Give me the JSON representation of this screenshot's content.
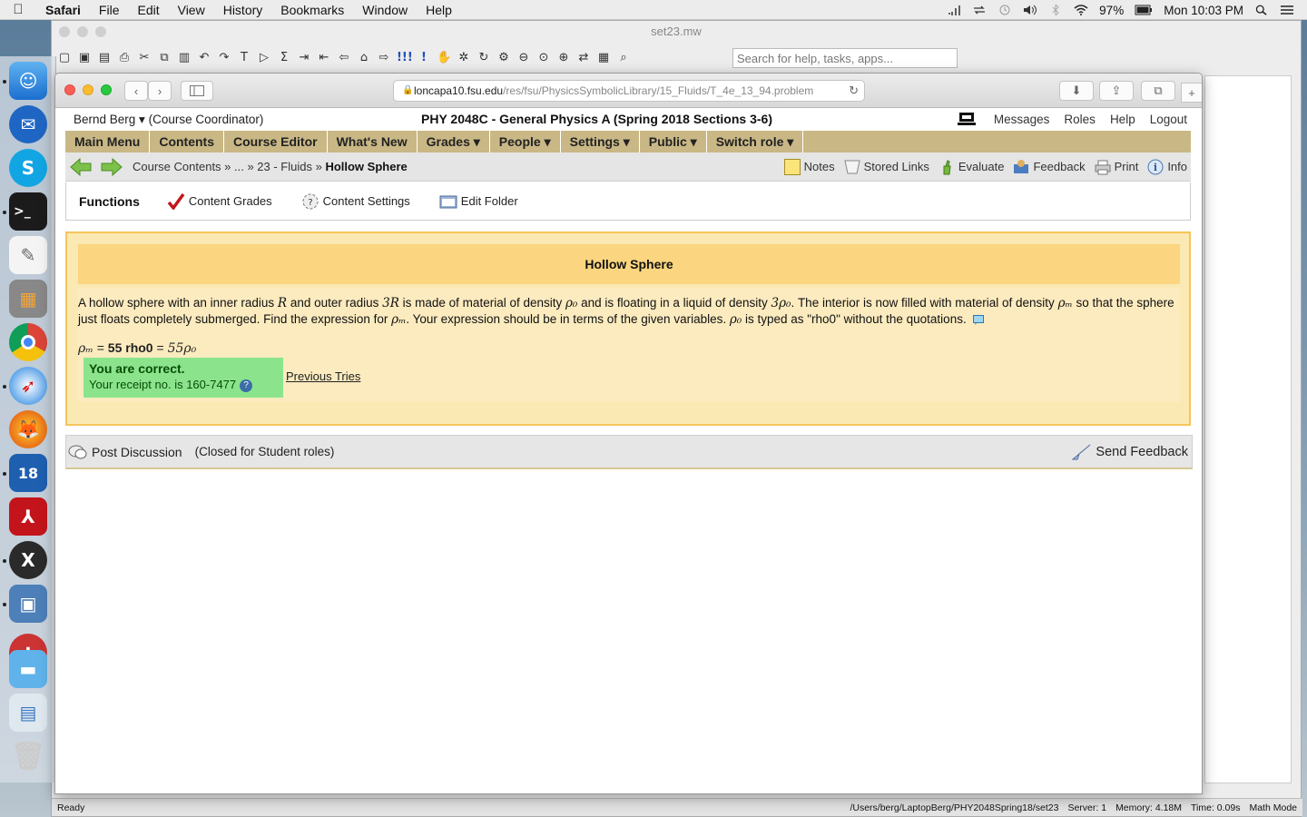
{
  "menubar": {
    "app": "Safari",
    "items": [
      "File",
      "Edit",
      "View",
      "History",
      "Bookmarks",
      "Window",
      "Help"
    ],
    "battery": "97%",
    "clock": "Mon 10:03 PM"
  },
  "maple": {
    "title": "set23.mw",
    "search_placeholder": "Search for help, tasks, apps...",
    "status_left": "Ready",
    "status_path": "/Users/berg/LaptopBerg/PHY2048Spring18/set23",
    "status_server": "Server: 1",
    "status_memory": "Memory: 4.18M",
    "status_time": "Time: 0.09s",
    "status_mode": "Math Mode"
  },
  "safari": {
    "url_host": "loncapa10.fsu.edu",
    "url_path": "/res/fsu/PhysicsSymbolicLibrary/15_Fluids/T_4e_13_94.problem"
  },
  "page": {
    "user": "Bernd Berg ▾",
    "role": "(Course Coordinator)",
    "course_title": "PHY 2048C - General Physics A (Spring 2018 Sections 3-6)",
    "top_links": [
      "Messages",
      "Roles",
      "Help",
      "Logout"
    ],
    "main_menu": [
      "Main Menu",
      "Contents",
      "Course Editor",
      "What's New",
      "Grades ▾",
      "People ▾",
      "Settings ▾",
      "Public ▾",
      "Switch role ▾"
    ],
    "breadcrumb": {
      "prefix": "Course Contents » ... » 23 - Fluids » ",
      "current": "Hollow Sphere"
    },
    "bread_tools": [
      "Notes",
      "Stored Links",
      "Evaluate",
      "Feedback",
      "Print",
      "Info"
    ],
    "functions": {
      "title": "Functions",
      "items": [
        "Content Grades",
        "Content Settings",
        "Edit Folder"
      ]
    },
    "problem": {
      "title": "Hollow Sphere",
      "text_1": "A hollow sphere with an inner radius ",
      "sym_R": "R",
      "text_2": " and outer radius ",
      "sym_3R": "3R",
      "text_3": " is made of material of density ",
      "sym_rho0": "ρ₀",
      "text_4": " and is floating in a liquid of density ",
      "sym_3rho0": "3ρ₀",
      "text_5": ". The interior is now filled with material of density ",
      "sym_rhom": "ρₘ",
      "text_6": " so that the sphere just floats completely submerged. Find the expression for ",
      "sym_rhom2": "ρₘ",
      "text_7": ". Your expression should be in terms of the given variables. ",
      "sym_rho0b": "ρ₀",
      "text_8": " is typed as \"rho0\" without the quotations.",
      "answer_lhs": "ρₘ",
      "answer_eq": " = ",
      "answer_typed": "55 rho0",
      "answer_eq2": " = ",
      "answer_rendered": "55ρ₀",
      "correct": "You are correct.",
      "receipt": "Your receipt no. is 160-7477",
      "previous_tries": "Previous Tries"
    },
    "discussion": {
      "post": "Post Discussion",
      "closed": "(Closed for Student roles)",
      "send_feedback": "Send Feedback"
    }
  }
}
